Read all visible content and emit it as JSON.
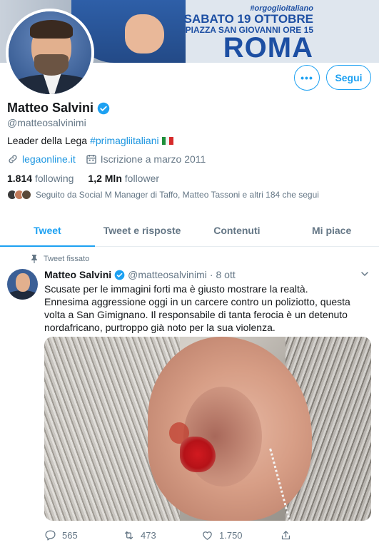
{
  "banner": {
    "hashtag": "#orgoglioitaliano",
    "date_line": "SABATO 19 OTTOBRE",
    "place_line": "PIAZZA SAN GIOVANNI ORE 15",
    "city": "ROMA",
    "brand_color": "#1d4fa3"
  },
  "profile": {
    "more_label": "•••",
    "follow_label": "Segui",
    "name": "Matteo Salvini",
    "handle": "@matteosalvinimi",
    "bio_text": "Leader della Lega",
    "bio_hashtag": "#primagliitaliani",
    "website": "legaonline.it",
    "joined": "Iscrizione a marzo 2011",
    "following_count": "1.814",
    "following_label": "following",
    "followers_count": "1,2 Mln",
    "followers_label": "follower",
    "followed_by": "Seguito da Social M Manager di Taffo, Matteo Tassoni e altri 184 che segui"
  },
  "tabs": [
    {
      "label": "Tweet",
      "active": true
    },
    {
      "label": "Tweet e risposte",
      "active": false
    },
    {
      "label": "Contenuti",
      "active": false
    },
    {
      "label": "Mi piace",
      "active": false
    }
  ],
  "tweet": {
    "pinned_label": "Tweet fissato",
    "author_name": "Matteo Salvini",
    "author_handle": "@matteosalvinimi",
    "separator": "·",
    "date": "8 ott",
    "text": "Scusate per le immagini forti ma è giusto mostrare la realtà.\nEnnesima aggressione oggi in un carcere contro un poliziotto, questa volta a San Gimignano. Il responsabile di tanta ferocia è un detenuto nordafricano, purtroppo già noto per la sua violenza.",
    "replies": "565",
    "retweets": "473",
    "likes": "1.750"
  },
  "colors": {
    "accent": "#1da1f2",
    "link": "#1b95e0",
    "muted": "#657786"
  }
}
